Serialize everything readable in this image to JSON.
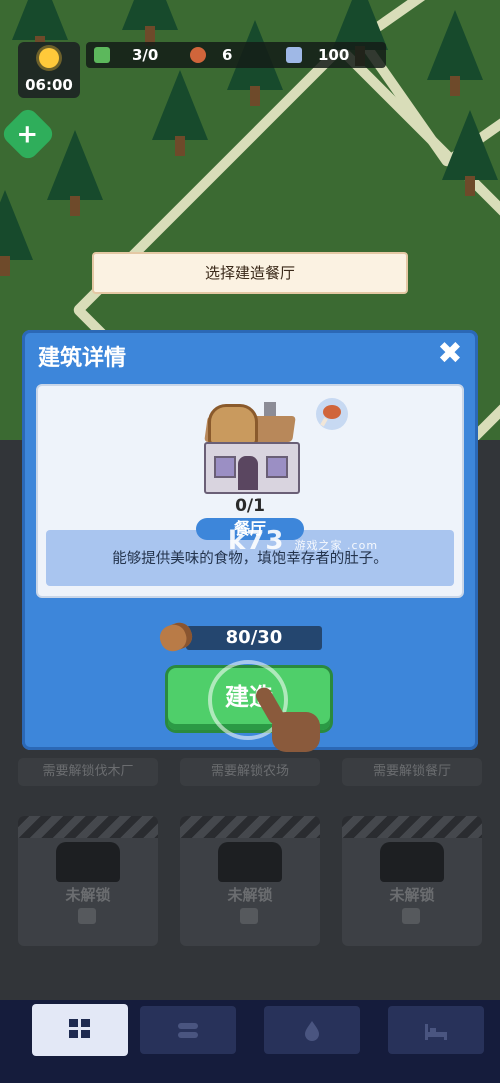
{
  "hud": {
    "time": "06:00",
    "survivors": "3/0",
    "food": "6",
    "water": "100"
  },
  "toast": "选择建造餐厅",
  "dialog": {
    "title": "建筑详情",
    "building": {
      "count": "0/1",
      "name": "餐厅",
      "description": "能够提供美味的食物，填饱幸存者的肚子。"
    },
    "cost": "80/30",
    "build_button": "建造"
  },
  "watermark": "k73",
  "watermark_sub": "游戏之家\n.com",
  "background_grid": {
    "unlock_labels": [
      "需要解锁伐木厂",
      "需要解锁农场",
      "需要解锁餐厅"
    ],
    "locked_label": "未解锁"
  },
  "tabs": [
    {
      "icon": "grid-icon",
      "active": true
    },
    {
      "icon": "logs-icon",
      "active": false
    },
    {
      "icon": "water-drop-icon",
      "active": false
    },
    {
      "icon": "bed-icon",
      "active": false
    }
  ],
  "colors": {
    "dialog_blue": "#3d86da",
    "build_green": "#4fcf6a",
    "tabbar": "#151c3c"
  }
}
